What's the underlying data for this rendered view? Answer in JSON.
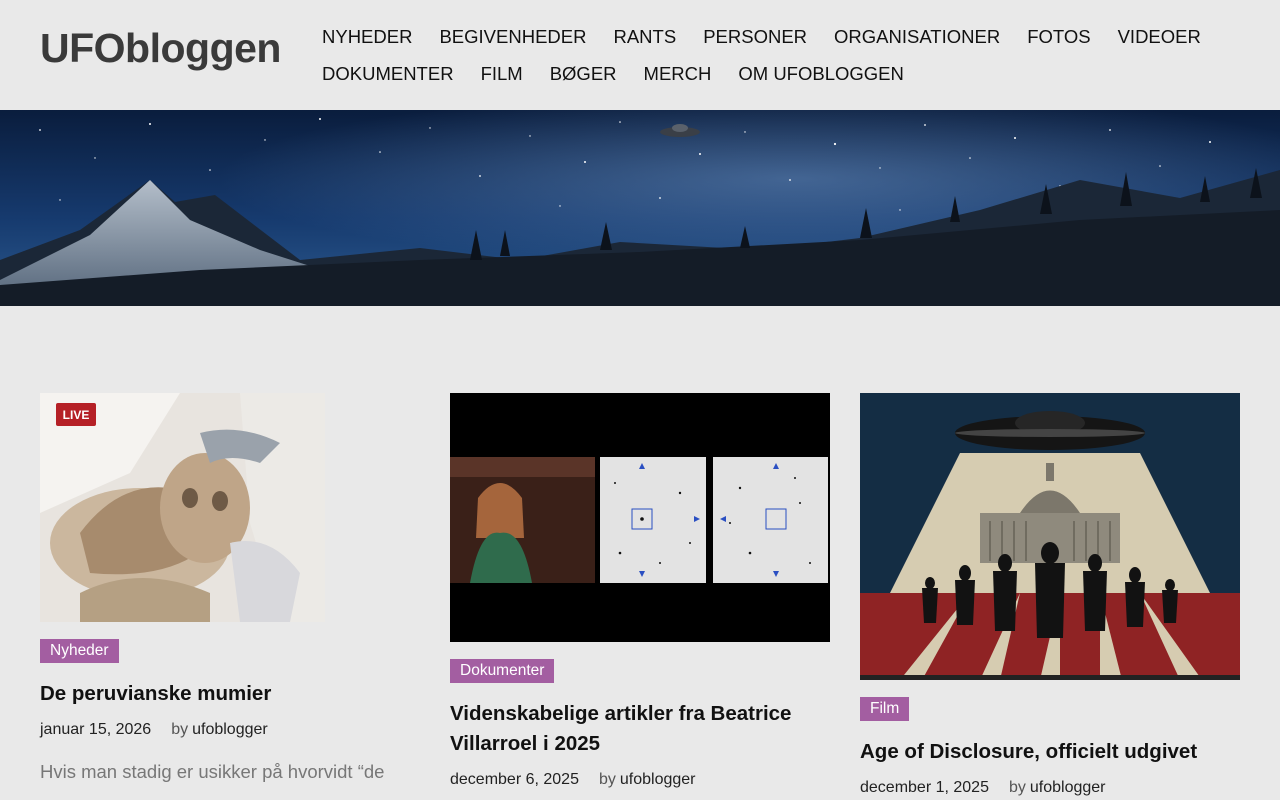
{
  "site": {
    "title": "UFObloggen"
  },
  "nav": {
    "row1": [
      "NYHEDER",
      "BEGIVENHEDER",
      "RANTS",
      "PERSONER",
      "ORGANISATIONER",
      "FOTOS",
      "VIDEOER"
    ],
    "row2": [
      "DOKUMENTER",
      "FILM",
      "BØGER",
      "MERCH",
      "OM UFOBLOGGEN"
    ]
  },
  "posts": [
    {
      "category": "Nyheder",
      "title": "De peruvianske mumier",
      "date": "januar 15, 2026",
      "by": "by",
      "author": "ufoblogger",
      "excerpt": "Hvis man stadig er usikker på hvorvidt “de",
      "thumb_badge": "LIVE"
    },
    {
      "category": "Dokumenter",
      "title": "Videnskabelige artikler fra Beatrice Villarroel i 2025",
      "date": "december 6, 2025",
      "by": "by",
      "author": "ufoblogger"
    },
    {
      "category": "Film",
      "title": "Age of Disclosure, officielt udgivet",
      "date": "december 1, 2025",
      "by": "by",
      "author": "ufoblogger"
    }
  ],
  "colors": {
    "accent": "#a35ea1",
    "background": "#e9e9e9"
  }
}
